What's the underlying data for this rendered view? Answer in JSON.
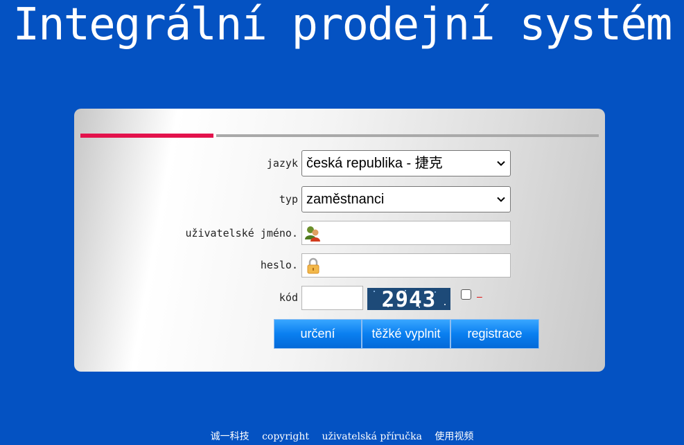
{
  "app": {
    "title": "Integrální prodejní systém"
  },
  "form": {
    "language": {
      "label": "jazyk",
      "value": "česká republika - 捷克"
    },
    "type": {
      "label": "typ",
      "value": "zaměstnanci"
    },
    "username": {
      "label": "uživatelské jméno.",
      "value": ""
    },
    "password": {
      "label": "heslo.",
      "value": ""
    },
    "code": {
      "label": "kód",
      "value": "",
      "captcha": "2943",
      "dash": "–"
    },
    "buttons": {
      "submit": "určení",
      "hard_fill": "těžké vyplnit",
      "register": "registrace"
    }
  },
  "footer": {
    "company": "诚一科技",
    "copyright": "copyright",
    "manual": "uživatelská příručka",
    "video": "使用视频"
  },
  "colors": {
    "background": "#0452c2",
    "accent_bar": "#e3124c",
    "button": "#0a7ff0"
  },
  "icons": {
    "username": "user-icon",
    "password": "lock-icon",
    "select": "chevron-down-icon"
  }
}
